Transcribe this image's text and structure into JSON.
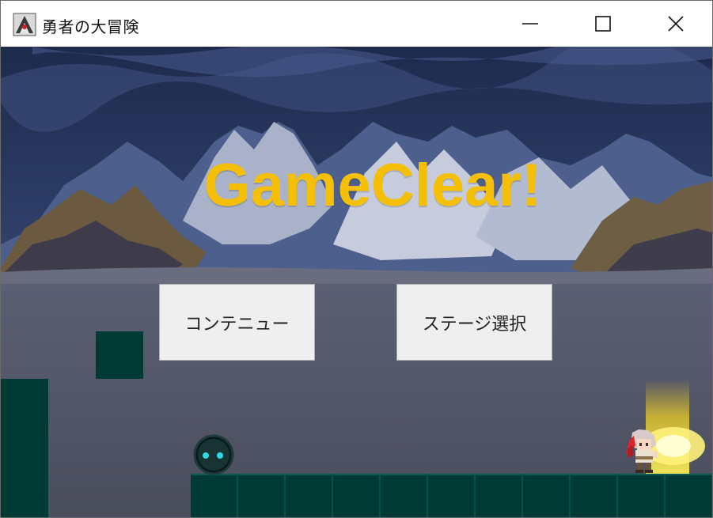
{
  "window": {
    "title": "勇者の大冒険",
    "controls": [
      "minimize",
      "maximize",
      "close"
    ]
  },
  "game": {
    "headline": "GameClear!",
    "headline_color": "#f5bf05",
    "buttons": {
      "continue_label": "コンテニュー",
      "stage_select_label": "ステージ選択"
    },
    "colors": {
      "block": "#003a35",
      "enemy_eyes": "#2fd9e6"
    }
  }
}
